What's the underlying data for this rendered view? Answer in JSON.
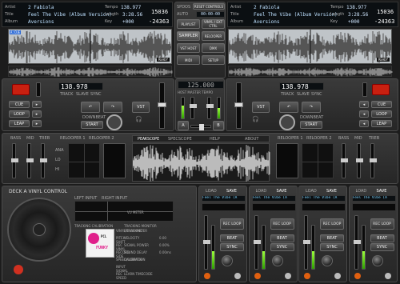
{
  "deck_a": {
    "artist_label": "Artist",
    "artist": "2 Fabiola",
    "title_label": "Title",
    "title": "Feel The Vibe (Album Version)",
    "album_label": "Album",
    "album": "Aversions",
    "tempo_label": "Tempo",
    "tempo": "138.977",
    "length_label": "Length",
    "length": "3:28.56",
    "key_label": "Key",
    "key": "+000",
    "time_top": "15036",
    "time_bottom": "-24363",
    "cue_marker": "A:CUE",
    "ready": "READY",
    "bpm": "138.978",
    "pitch_label": "+0.000",
    "track": "TRACK",
    "slave": "SLAVE",
    "sync": "SYNC",
    "vst": "VST",
    "cue": "CUE",
    "loop": "LOOP",
    "leap": "LEAP",
    "downbeat": "DOWNBEAT",
    "start": "START",
    "vs": "VS"
  },
  "deck_b": {
    "artist_label": "Artist",
    "artist": "2 Fabiola",
    "title_label": "Title",
    "title": "Feel The Vibe (Album Version)",
    "album_label": "Album",
    "album": "Aversions",
    "tempo_label": "Tempo",
    "tempo": "138.977",
    "length_label": "Length",
    "length": "3:28.56",
    "key_label": "Key",
    "key": "+000",
    "time_top": "15036",
    "time_bottom": "-24363",
    "ready": "READY",
    "bpm": "138.978",
    "pitch_label": "+0.000",
    "track": "TRACK",
    "slave": "SLAVE",
    "sync": "SYNC",
    "vst": "VST",
    "cue": "CUE",
    "loop": "LOOP",
    "leap": "LEAP",
    "downbeat": "DOWNBEAT",
    "start": "START"
  },
  "center": {
    "sp_dos": "SPDOS",
    "reset_controls": "RESET CONTROLS",
    "clock": "00:00:00",
    "auto": "AUTO",
    "a": "A",
    "b": "B",
    "playlist": "PLAYLIST",
    "vinyl_ext": "VINYL / EXT CTRL",
    "sampler": "SAMPLER",
    "relooper": "RELOOPER",
    "vst_host": "VST HOST",
    "dmx": "DMX",
    "midi": "MIDI",
    "setup": "SETUP",
    "master_bpm": "125.000",
    "host_master_tempo": "HOST MASTER TEMPO"
  },
  "fx_row": {
    "bass": "BASS",
    "mid": "MID",
    "treb": "TREB",
    "relooper_1_left": "RELOOPER 1",
    "relooper_2_left": "RELOOPER 2",
    "peakscope": "PEAKSCOPE",
    "specscope": "SPECSCOPE",
    "help": "HELP",
    "about": "ABOUT",
    "relooper_1_right": "RELOOPER 1",
    "relooper_2_right": "RELOOPER 2",
    "ana": "ANA",
    "lo": "LO",
    "hi": "HI"
  },
  "vinyl": {
    "title": "DECK A VINYL CONTROL",
    "left_input": "LEFT INPUT",
    "right_input": "RIGHT INPUT",
    "vu_meter": "VU METER",
    "tracking_calibration": "TRACKING CALIBRATION",
    "tracking_monitor": "TRACKING MONITOR",
    "logo_line1": "PCL",
    "logo_line2": "FUNKY",
    "rows_left": [
      "VINYL/TRACKING",
      "PITCH SHIFT",
      "REC VINYL",
      "RECORD SIDE",
      "SPEED/SCRATCH",
      "INPUT SIGNAL",
      "REC SPEED"
    ],
    "rows_right": [
      "ERROR METER",
      "VELOCITY",
      "SIGNAL POWER",
      "SOUND DELAY",
      "CALIBRATION",
      "",
      "LEARN TIMECODE"
    ],
    "values_right": [
      "",
      "0.00",
      "0.00%",
      "0.00ms",
      "",
      "",
      ""
    ]
  },
  "sampler": {
    "decks": [
      {
        "load": "LOAD",
        "save": "SAVE",
        "name": "Feel The Vibe (A",
        "rec": "REC LOOP",
        "beat": "BEAT",
        "sync": "SYNC"
      },
      {
        "load": "LOAD",
        "save": "SAVE",
        "name": "Feel The Vibe (A",
        "rec": "REC LOOP",
        "beat": "BEAT",
        "sync": "SYNC"
      },
      {
        "load": "LOAD",
        "save": "SAVE",
        "name": "Feel The Vibe (A",
        "rec": "REC LOOP",
        "beat": "BEAT",
        "sync": "SYNC"
      },
      {
        "load": "LOAD",
        "save": "SAVE",
        "name": "Feel The Vibe (A",
        "rec": "REC LOOP",
        "beat": "BEAT",
        "sync": "SYNC"
      }
    ]
  }
}
